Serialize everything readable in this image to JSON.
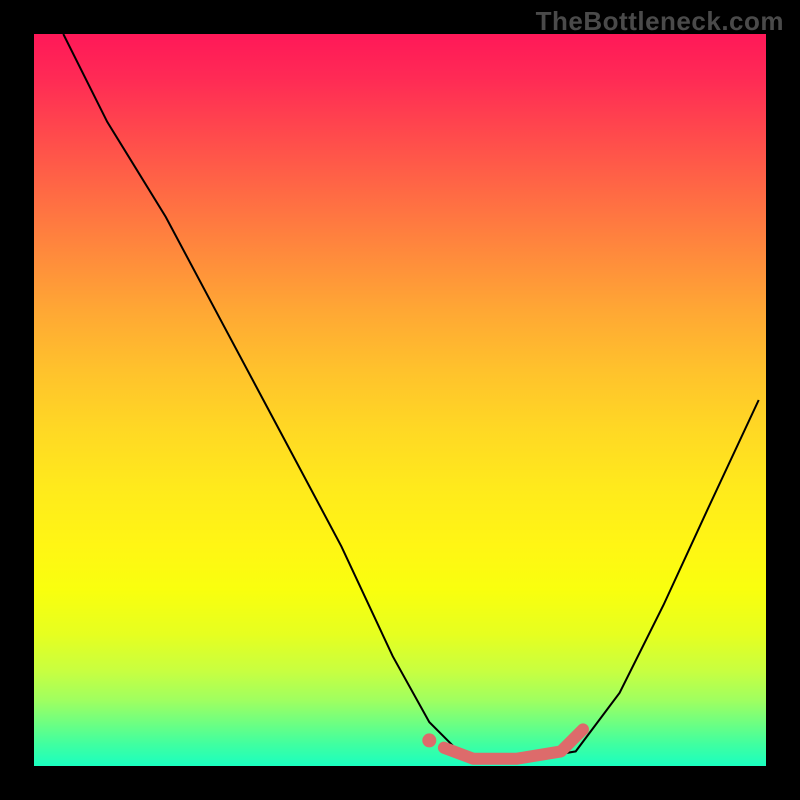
{
  "watermark": "TheBottleneck.com",
  "chart_data": {
    "type": "line",
    "title": "",
    "xlabel": "",
    "ylabel": "",
    "xlim": [
      0,
      100
    ],
    "ylim": [
      0,
      100
    ],
    "series": [
      {
        "name": "curve",
        "x": [
          4,
          10,
          18,
          26,
          34,
          42,
          49,
          54,
          58,
          62,
          68,
          74,
          80,
          86,
          92,
          99
        ],
        "y": [
          100,
          88,
          75,
          60,
          45,
          30,
          15,
          6,
          2,
          1,
          1,
          2,
          10,
          22,
          35,
          50
        ]
      },
      {
        "name": "highlight",
        "x": [
          56,
          60,
          66,
          72,
          75
        ],
        "y": [
          2.5,
          1,
          1,
          2,
          5
        ]
      }
    ],
    "highlight_color": "#dd6b6b",
    "curve_color": "#000000"
  }
}
